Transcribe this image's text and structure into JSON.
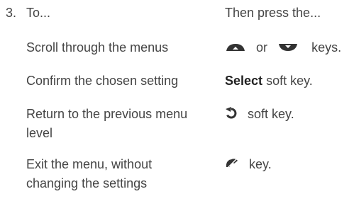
{
  "step": {
    "number": "3.",
    "header_left": "To...",
    "header_right": "Then press the..."
  },
  "rows": [
    {
      "action": "Scroll through the menus",
      "icons": [
        "scroll-up-key-icon",
        "scroll-down-key-icon"
      ],
      "connector": "or",
      "suffix": "keys."
    },
    {
      "action": "Confirm the chosen setting",
      "bold_label": "Select",
      "suffix": "soft key."
    },
    {
      "action": "Return to the previous menu level",
      "icons": [
        "back-arrow-icon"
      ],
      "suffix": "soft key."
    },
    {
      "action": "Exit the menu, without changing the settings",
      "icons": [
        "end-call-key-icon"
      ],
      "suffix": "key."
    }
  ],
  "colors": {
    "text": "#444444",
    "bold_text": "#222222",
    "icon": "#333333"
  }
}
